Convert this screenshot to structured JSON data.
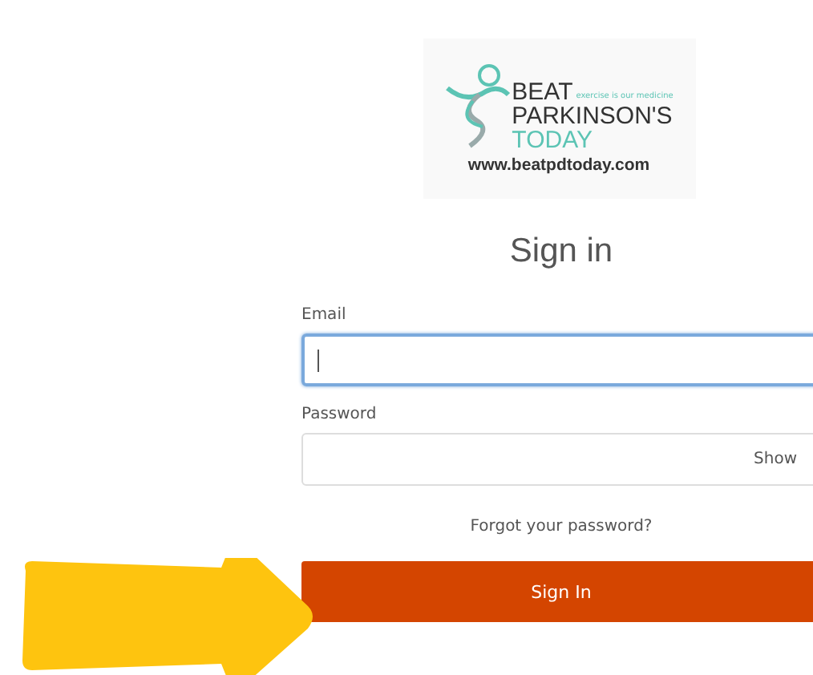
{
  "logo": {
    "line_1": "BEAT",
    "tagline": "exercise is our medicine",
    "line_2": "PARKINSON'S",
    "line_3": "TODAY",
    "url": "www.beatpdtoday.com"
  },
  "title": "Sign in",
  "fields": [
    {
      "label": "Email",
      "focused": true
    },
    {
      "label": "Password",
      "focused": false,
      "toggle": "Show"
    }
  ],
  "forgot_link": "Forgot your password?",
  "submit": "Sign In"
}
